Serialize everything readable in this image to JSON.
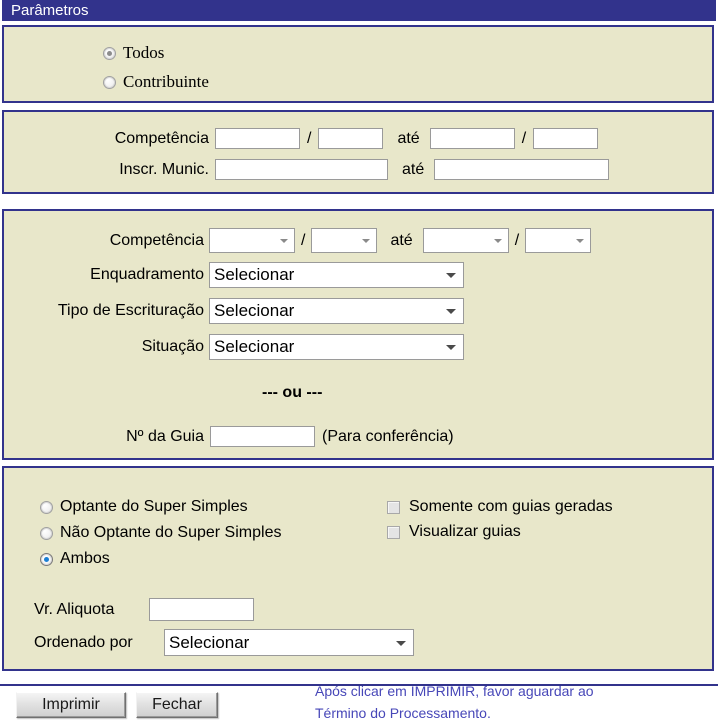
{
  "window": {
    "title": "Parâmetros"
  },
  "scope_panel": {
    "options": [
      {
        "label": "Todos",
        "selected": true
      },
      {
        "label": "Contribuinte",
        "selected": false
      }
    ]
  },
  "range_panel": {
    "rows": [
      {
        "label": "Competência",
        "separator": "/",
        "until": "até",
        "fields": [
          {
            "value": "",
            "placeholder": ""
          },
          {
            "value": "",
            "placeholder": ""
          },
          {
            "value": "",
            "placeholder": ""
          },
          {
            "value": "",
            "placeholder": ""
          }
        ]
      },
      {
        "label": "Inscr. Munic.",
        "until": "até",
        "fields": [
          {
            "value": "",
            "placeholder": ""
          },
          {
            "value": "",
            "placeholder": ""
          }
        ]
      }
    ]
  },
  "filter_panel": {
    "competencia": {
      "label": "Competência",
      "separator": "/",
      "until": "até",
      "selects": [
        {
          "value": ""
        },
        {
          "value": ""
        },
        {
          "value": ""
        },
        {
          "value": ""
        }
      ]
    },
    "dropdowns": [
      {
        "label": "Enquadramento",
        "value": "Selecionar"
      },
      {
        "label": "Tipo de Escrituração",
        "value": "Selecionar"
      },
      {
        "label": "Situação",
        "value": "Selecionar"
      }
    ],
    "separator_text": "--- ou ---",
    "guia": {
      "label": "Nº da Guia",
      "value": "",
      "hint": "(Para conferência)"
    }
  },
  "simples_panel": {
    "radios": [
      {
        "label": "Optante do Super Simples",
        "selected": false
      },
      {
        "label": "Não Optante do Super Simples",
        "selected": false
      },
      {
        "label": "Ambos",
        "selected": true
      }
    ],
    "checkboxes": [
      {
        "label": "Somente com guias geradas",
        "checked": false
      },
      {
        "label": "Visualizar guias",
        "checked": false
      }
    ],
    "aliquota": {
      "label": "Vr. Aliquota",
      "value": ""
    },
    "ordenado": {
      "label": "Ordenado por",
      "value": "Selecionar"
    }
  },
  "footer": {
    "print_button": "Imprimir",
    "close_button": "Fechar",
    "note_line1": "Após clicar em IMPRIMIR, favor aguardar ao",
    "note_line2": "Término do Processamento."
  },
  "colors": {
    "title_bar": "#32338c",
    "panel_bg": "#e8e7ca",
    "panel_border": "#32338c",
    "note_text": "#4747b8",
    "radio_active": "#1a7fd4"
  }
}
